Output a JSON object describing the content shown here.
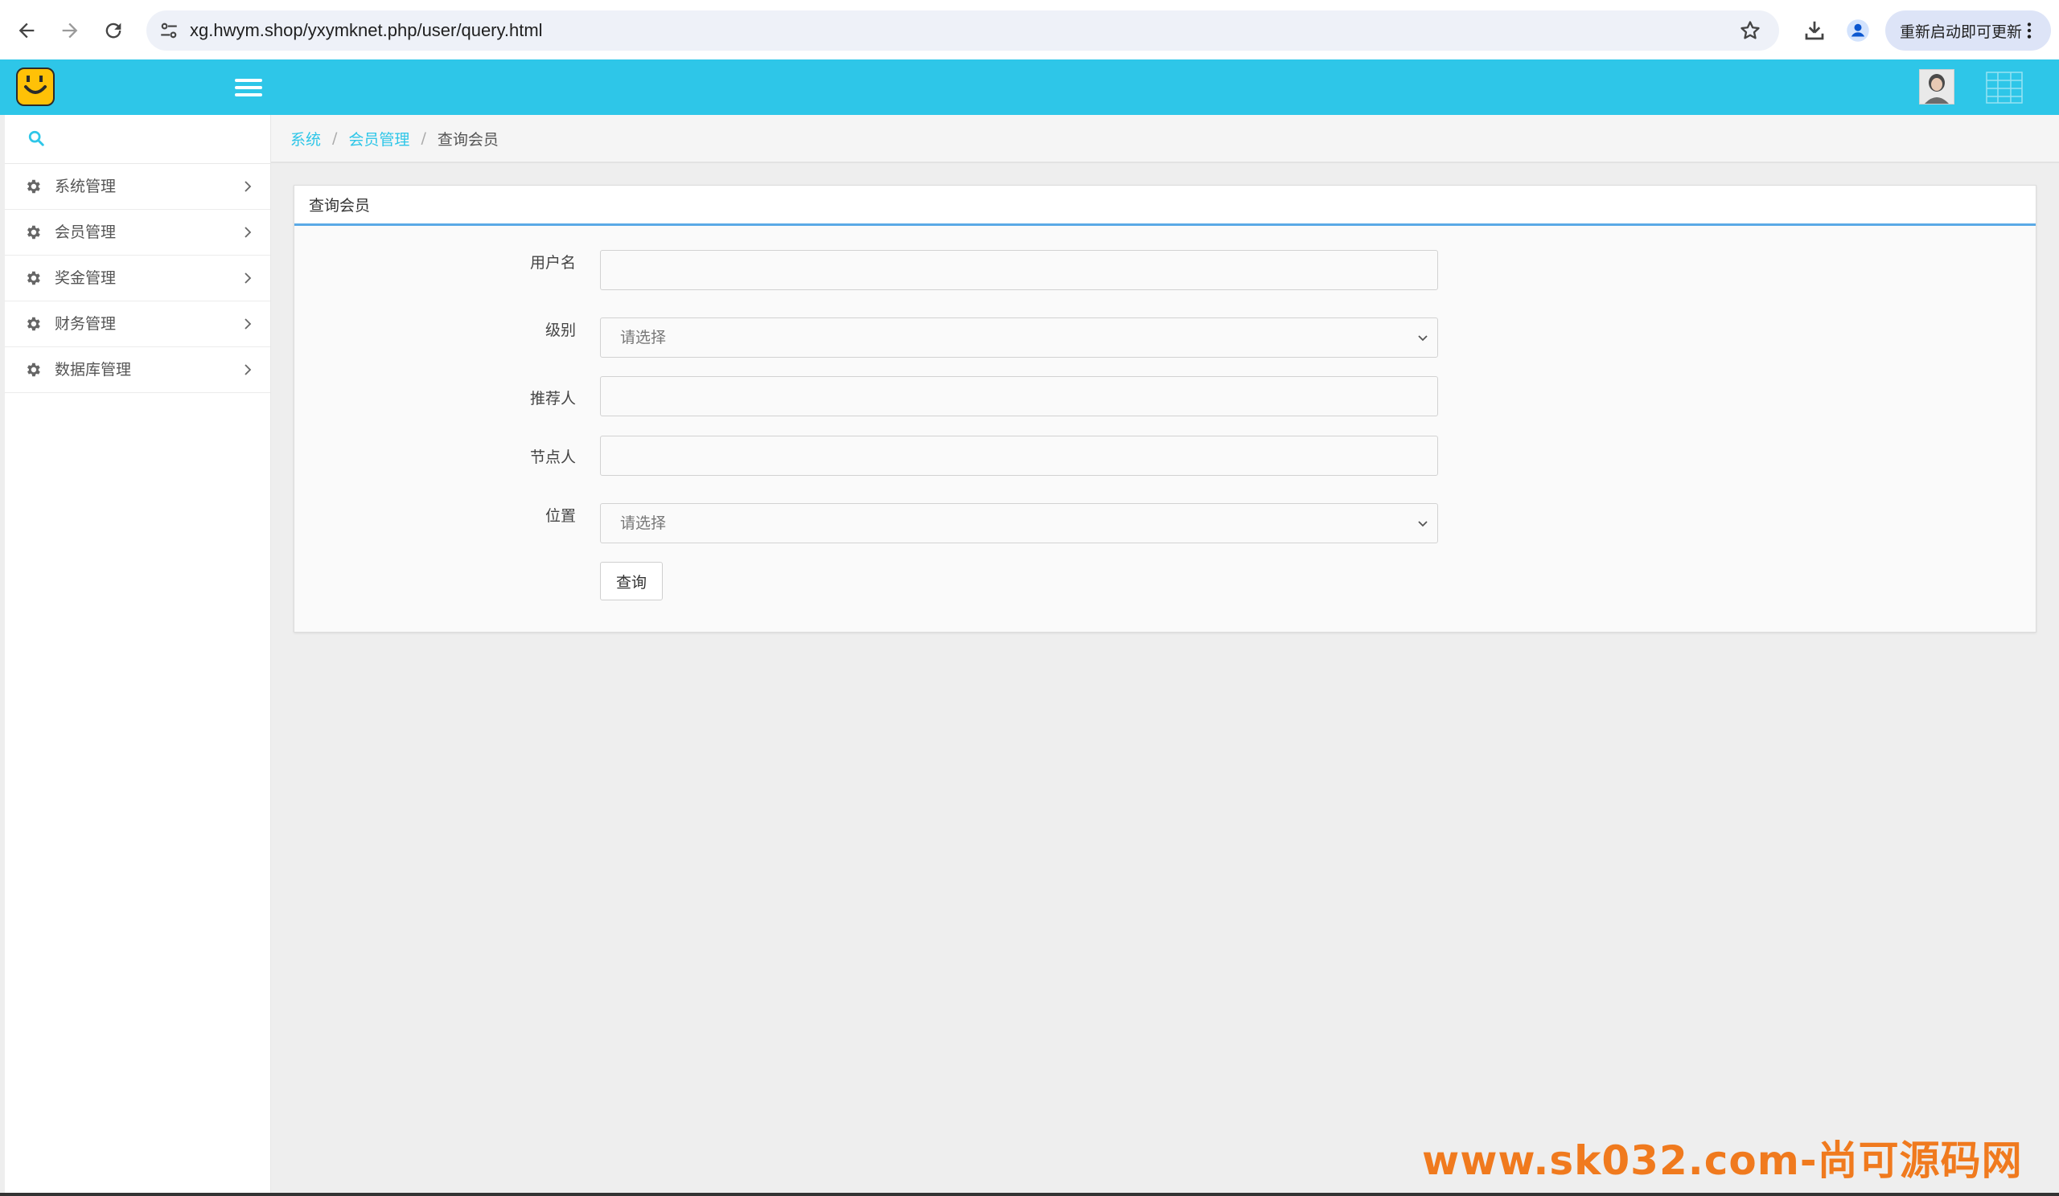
{
  "browser": {
    "url": "xg.hwym.shop/yxymknet.php/user/query.html",
    "update_button": "重新启动即可更新"
  },
  "icons": {
    "back": "arrow-left-icon",
    "forward": "arrow-right-icon",
    "reload": "reload-icon",
    "site_info": "tune-icon",
    "bookmark": "star-icon",
    "download": "download-icon",
    "profile": "person-icon",
    "menu": "hamburger-icon",
    "search": "search-icon",
    "nav_item": "gear-icon",
    "submenu": "chevron-right-icon",
    "dropdown": "chevron-down-icon"
  },
  "colors": {
    "header": "#2ec6e8",
    "logo": "#ffc107",
    "link": "#2ec6e8",
    "panel_accent": "#5aa9e6",
    "watermark": "#f07a1e"
  },
  "sidebar": {
    "items": [
      {
        "label": "系统管理"
      },
      {
        "label": "会员管理"
      },
      {
        "label": "奖金管理"
      },
      {
        "label": "财务管理"
      },
      {
        "label": "数据库管理"
      }
    ]
  },
  "breadcrumb": {
    "items": [
      "系统",
      "会员管理"
    ],
    "current": "查询会员"
  },
  "panel": {
    "title": "查询会员",
    "fields": {
      "username": {
        "label": "用户名",
        "value": ""
      },
      "level": {
        "label": "级别",
        "placeholder": "请选择"
      },
      "referrer": {
        "label": "推荐人",
        "value": ""
      },
      "node": {
        "label": "节点人",
        "value": ""
      },
      "position": {
        "label": "位置",
        "placeholder": "请选择"
      }
    },
    "submit": "查询"
  },
  "watermark": "www.sk032.com-尚可源码网"
}
